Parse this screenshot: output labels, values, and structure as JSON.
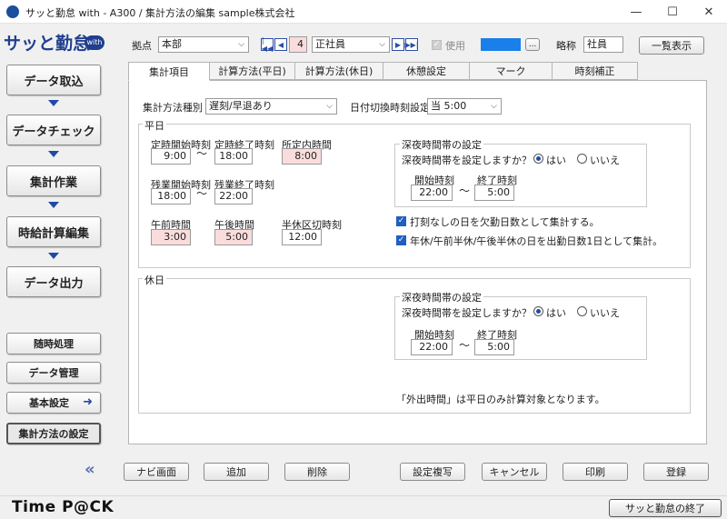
{
  "window": {
    "title": "サッと勤怠 with - A300 / 集計方法の編集  sample株式会社",
    "minimize_glyph": "—",
    "maximize_glyph": "☐",
    "close_glyph": "✕"
  },
  "logo": {
    "text": "サッと勤怠",
    "badge": "with"
  },
  "nav": {
    "main": [
      "データ取込",
      "データチェック",
      "集計作業",
      "時給計算編集",
      "データ出力"
    ],
    "sub": [
      "随時処理",
      "データ管理",
      "基本設定",
      "集計方法の設定"
    ],
    "collapse_glyph": "«"
  },
  "top": {
    "site_label": "拠点",
    "site_value": "本部",
    "record_number": "4",
    "record_value": "正社員",
    "use_label": "使用",
    "color_swatch": "#1a7fe8",
    "ellipsis": "...",
    "short_label": "略称",
    "short_value": "社員",
    "list_button": "一覧表示",
    "first_glyph": "|◀◀",
    "prev_glyph": "◀",
    "next_glyph": "▶",
    "last_glyph": "▶▶|"
  },
  "tabs": [
    "集計項目",
    "計算方法(平日)",
    "計算方法(休日)",
    "休憩設定",
    "マーク",
    "時刻補正"
  ],
  "panel": {
    "method_type_label": "集計方法種別",
    "method_type_value": "遅刻/早退あり",
    "date_switch_label": "日付切換時刻設定",
    "date_switch_value": "当 5:00",
    "weekday": {
      "title": "平日",
      "start_label": "定時開始時刻",
      "start_value": "9:00",
      "end_label": "定時終了時刻",
      "end_value": "18:00",
      "scheduled_label": "所定内時間",
      "scheduled_value": "8:00",
      "ot_start_label": "残業開始時刻",
      "ot_start_value": "18:00",
      "ot_end_label": "残業終了時刻",
      "ot_end_value": "22:00",
      "am_label": "午前時間",
      "am_value": "3:00",
      "pm_label": "午後時間",
      "pm_value": "5:00",
      "half_label": "半休区切時刻",
      "half_value": "12:00",
      "night": {
        "title": "深夜時間帯の設定",
        "question": "深夜時間帯を設定しますか？",
        "yes": "はい",
        "no": "いいえ",
        "start_label": "開始時刻",
        "start_value": "22:00",
        "end_label": "終了時刻",
        "end_value": "5:00"
      },
      "check1": "打刻なしの日を欠勤日数として集計する。",
      "check2": "年休/午前半休/午後半休の日を出勤日数1日として集計。"
    },
    "holiday": {
      "title": "休日",
      "night": {
        "title": "深夜時間帯の設定",
        "question": "深夜時間帯を設定しますか？",
        "yes": "はい",
        "no": "いいえ",
        "start_label": "開始時刻",
        "start_value": "22:00",
        "end_label": "終了時刻",
        "end_value": "5:00"
      },
      "note": "「外出時間」は平日のみ計算対象となります。"
    },
    "tilde": "〜"
  },
  "actions": {
    "navi": "ナビ画面",
    "add": "追加",
    "delete": "削除",
    "copy": "設定複写",
    "cancel": "キャンセル",
    "print": "印刷",
    "register": "登録"
  },
  "footer": {
    "brand": "Time P@CK",
    "exit": "サッと勤怠の終了"
  }
}
